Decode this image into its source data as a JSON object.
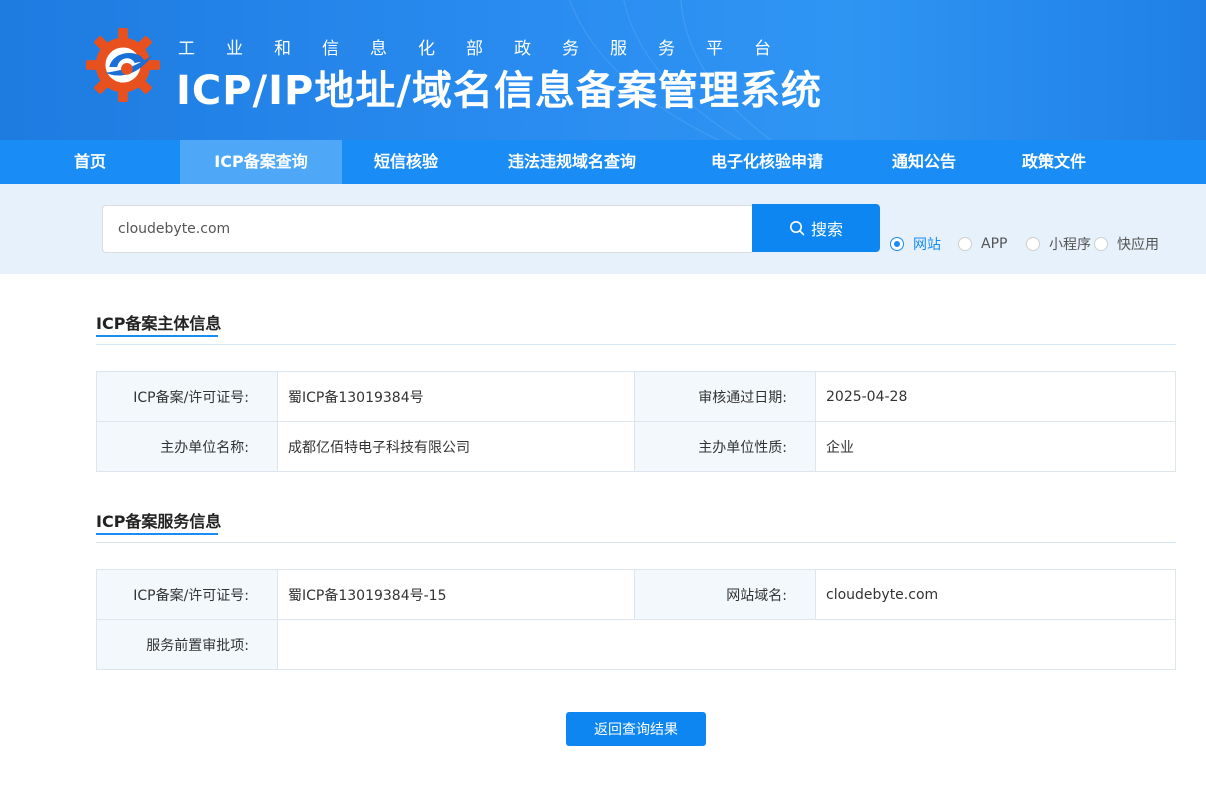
{
  "header": {
    "subtitle": "工业和信息化部政务服务平台",
    "title": "ICP/IP地址/域名信息备案管理系统"
  },
  "nav": {
    "items": [
      {
        "label": "首页"
      },
      {
        "label": "ICP备案查询",
        "active": true
      },
      {
        "label": "短信核验"
      },
      {
        "label": "违法违规域名查询"
      },
      {
        "label": "电子化核验申请"
      },
      {
        "label": "通知公告"
      },
      {
        "label": "政策文件"
      }
    ]
  },
  "search": {
    "value": "cloudebyte.com",
    "button_label": "搜索",
    "types": [
      {
        "label": "网站",
        "checked": true
      },
      {
        "label": "APP",
        "checked": false
      },
      {
        "label": "小程序",
        "checked": false
      },
      {
        "label": "快应用",
        "checked": false
      }
    ]
  },
  "subject_info": {
    "title": "ICP备案主体信息",
    "rows": [
      [
        {
          "label": "ICP备案/许可证号:",
          "value": "蜀ICP备13019384号"
        },
        {
          "label": "审核通过日期:",
          "value": "2025-04-28"
        }
      ],
      [
        {
          "label": "主办单位名称:",
          "value": "成都亿佰特电子科技有限公司"
        },
        {
          "label": "主办单位性质:",
          "value": "企业"
        }
      ]
    ]
  },
  "service_info": {
    "title": "ICP备案服务信息",
    "license_label": "ICP备案/许可证号:",
    "license_value": "蜀ICP备13019384号-15",
    "domain_label": "网站域名:",
    "domain_value": "cloudebyte.com",
    "pre_approval_label": "服务前置审批项:",
    "pre_approval_value": ""
  },
  "back_button_label": "返回查询结果",
  "colors": {
    "primary": "#1a8cf5",
    "button": "#0d86f2",
    "search_bg": "#e6f1fb",
    "label_bg": "#f3f8fc"
  }
}
